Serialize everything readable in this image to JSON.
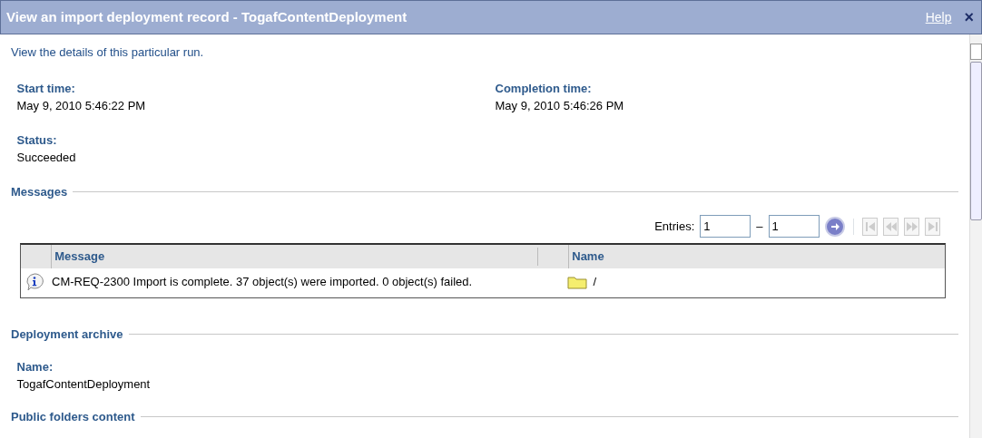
{
  "window": {
    "title": "View an import deployment record - TogafContentDeployment",
    "help": "Help",
    "close": "×"
  },
  "intro": "View the details of this particular run.",
  "fields": [
    {
      "label": "Start time:",
      "value": "May 9, 2010 5:46:22 PM"
    },
    {
      "label": "Completion time:",
      "value": "May 9, 2010 5:46:26 PM"
    },
    {
      "label": "Status:",
      "value": "Succeeded"
    }
  ],
  "messages": {
    "heading": "Messages",
    "entries_label": "Entries:",
    "from": "1",
    "separator": "–",
    "to": "1",
    "pager_disabled": true,
    "columns": [
      "Message",
      "Name"
    ],
    "rows": [
      {
        "message": "CM-REQ-2300 Import is complete. 37 object(s) were imported. 0 object(s) failed.",
        "name": "/"
      }
    ]
  },
  "archive": {
    "heading": "Deployment archive",
    "label": "Name:",
    "value": "TogafContentDeployment"
  },
  "public_folders": {
    "heading": "Public folders content"
  }
}
